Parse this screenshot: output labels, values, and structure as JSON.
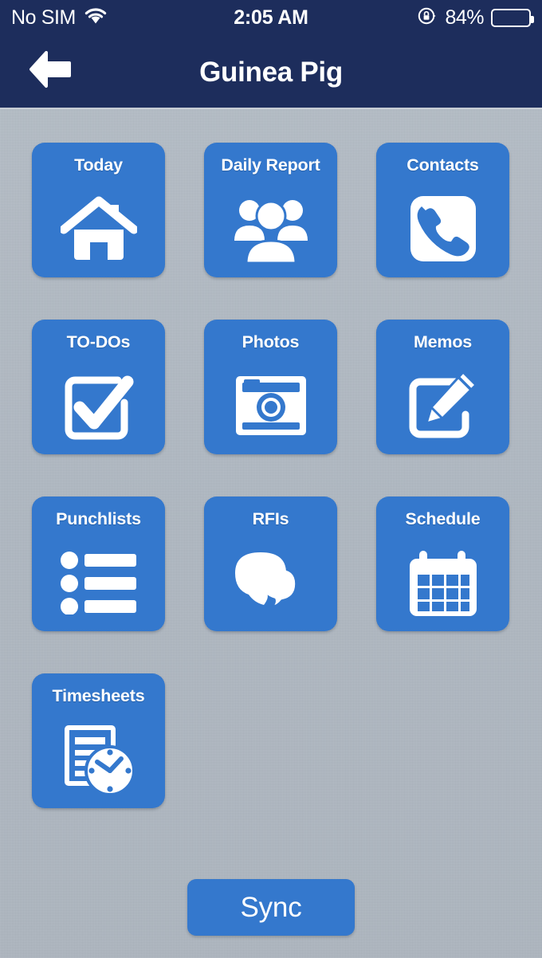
{
  "status_bar": {
    "carrier": "No SIM",
    "wifi_icon": "wifi-icon",
    "time": "2:05 AM",
    "rotation_lock_icon": "rotation-lock-icon",
    "battery_percent": "84%",
    "battery_level": 84
  },
  "nav_bar": {
    "back_icon": "back-arrow-icon",
    "title": "Guinea Pig"
  },
  "colors": {
    "nav_background": "#1d2d5c",
    "tile_blue": "#3478cd",
    "page_background": "#b2bbc5",
    "tile_text": "#ffffff"
  },
  "tiles": [
    {
      "label": "Today",
      "icon": "home-icon"
    },
    {
      "label": "Daily Report",
      "icon": "people-group-icon"
    },
    {
      "label": "Contacts",
      "icon": "phone-icon"
    },
    {
      "label": "TO-DOs",
      "icon": "checkbox-check-icon"
    },
    {
      "label": "Photos",
      "icon": "camera-icon"
    },
    {
      "label": "Memos",
      "icon": "note-pencil-icon"
    },
    {
      "label": "Punchlists",
      "icon": "bulleted-list-icon"
    },
    {
      "label": "RFIs",
      "icon": "speech-bubbles-icon"
    },
    {
      "label": "Schedule",
      "icon": "calendar-icon"
    },
    {
      "label": "Timesheets",
      "icon": "document-clock-icon"
    }
  ],
  "sync": {
    "label": "Sync"
  }
}
